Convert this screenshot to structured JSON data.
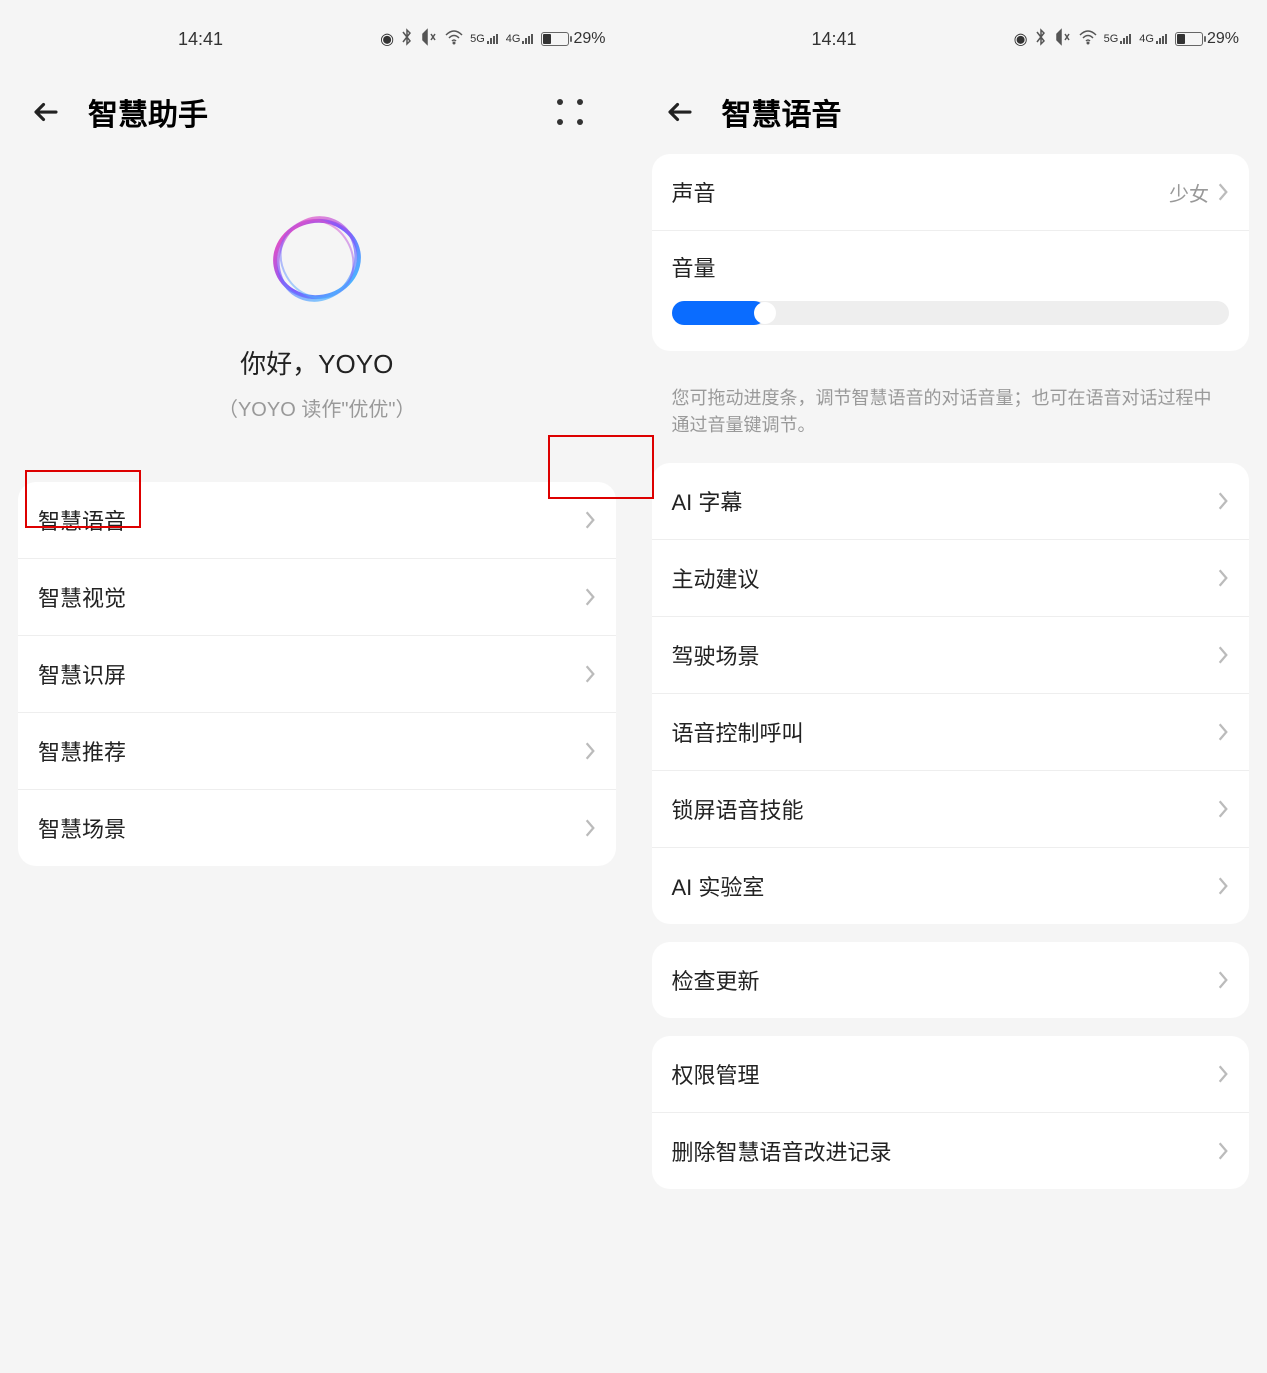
{
  "status": {
    "time": "14:41",
    "battery_percent": "29%",
    "sig1": "5G",
    "sig2": "4G"
  },
  "left": {
    "title": "智慧助手",
    "hero_title": "你好，YOYO",
    "hero_sub": "（YOYO 读作\"优优\"）",
    "items": [
      {
        "label": "智慧语音"
      },
      {
        "label": "智慧视觉"
      },
      {
        "label": "智慧识屏"
      },
      {
        "label": "智慧推荐"
      },
      {
        "label": "智慧场景"
      }
    ]
  },
  "right": {
    "title": "智慧语音",
    "sound_label": "声音",
    "sound_value": "少女",
    "volume_label": "音量",
    "volume_percent": 17,
    "hint": "您可拖动进度条，调节智慧语音的对话音量；也可在语音对话过程中通过音量键调节。",
    "group1": [
      {
        "label": "AI 字幕"
      },
      {
        "label": "主动建议"
      },
      {
        "label": "驾驶场景"
      },
      {
        "label": "语音控制呼叫"
      },
      {
        "label": "锁屏语音技能"
      },
      {
        "label": "AI 实验室"
      }
    ],
    "group2": [
      {
        "label": "检查更新"
      }
    ],
    "group3": [
      {
        "label": "权限管理"
      },
      {
        "label": "删除智慧语音改进记录"
      }
    ]
  }
}
